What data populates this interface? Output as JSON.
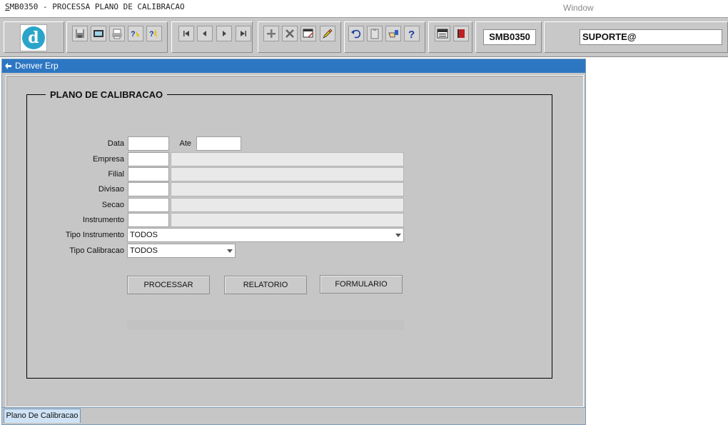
{
  "window": {
    "title_underlined": "S",
    "title_rest": "MB0350 - PROCESSA PLANO DE CALIBRACAO",
    "menu": "Window"
  },
  "toolbar": {
    "program_code": "SMB0350",
    "user": "SUPORTE@",
    "logo_letter": "d"
  },
  "inner_window": {
    "caption": "Denver Erp",
    "frame_title": "PLANO DE CALIBRACAO",
    "bottom_tab": "Plano De Calibracao"
  },
  "form": {
    "labels": {
      "data": "Data",
      "ate": "Ate",
      "empresa": "Empresa",
      "filial": "Filial",
      "divisao": "Divisao",
      "secao": "Secao",
      "instrumento": "Instrumento",
      "tipo_instrumento": "Tipo Instrumento",
      "tipo_calibracao": "Tipo Calibracao"
    },
    "values": {
      "data": "",
      "ate": "",
      "empresa": "",
      "filial": "",
      "divisao": "",
      "secao": "",
      "instrumento": "",
      "tipo_instrumento": "TODOS",
      "tipo_calibracao": "TODOS"
    },
    "buttons": {
      "processar": "PROCESSAR",
      "relatorio": "RELATORIO",
      "formulario": "FORMULARIO"
    }
  },
  "colors": {
    "caption_bar": "#2d77c2",
    "panel": "#c6c6c6",
    "logo": "#2aa5c9"
  }
}
